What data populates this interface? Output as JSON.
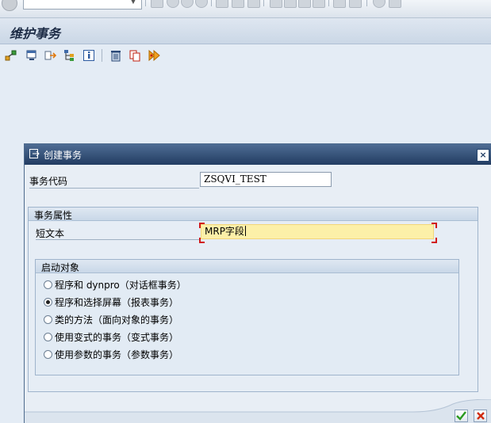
{
  "colors": {
    "title_text": "#1d2c46",
    "dialog_header": "#223c62",
    "active_field": "#fcf0a8",
    "required_marker": "#d11a1a",
    "confirm": "#2a9a1e",
    "cancel": "#d02a10"
  },
  "systembar": {
    "command_field_value": "",
    "icons": [
      "ok-icon",
      "command-dropdown-icon",
      "back-icon",
      "exit-icon",
      "cancel-icon",
      "print-icon",
      "find-icon",
      "find-next-icon",
      "first-page-icon",
      "previous-page-icon",
      "next-page-icon",
      "last-page-icon",
      "new-session-icon",
      "shortcut-icon",
      "help-icon",
      "layout-icon"
    ]
  },
  "header": {
    "title": "维护事务"
  },
  "toolbar": {
    "icons": [
      "other-object-icon",
      "display-change-icon",
      "where-used-icon",
      "hierarchy-icon",
      "info-icon",
      "delete-icon",
      "copy-icon",
      "test-icon"
    ]
  },
  "dialog": {
    "title": "创建事务",
    "close_label": "×",
    "tcode_label": "事务代码",
    "tcode_value": "ZSQVI_TEST",
    "attributes": {
      "title": "事务属性",
      "short_text_label": "短文本",
      "short_text_value": "MRP字段"
    },
    "start_object": {
      "title": "启动对象",
      "options": [
        {
          "label": "程序和 dynpro（对话框事务）",
          "selected": false
        },
        {
          "label": "程序和选择屏幕（报表事务）",
          "selected": true
        },
        {
          "label": "类的方法（面向对象的事务）",
          "selected": false
        },
        {
          "label": "使用变式的事务（变式事务）",
          "selected": false
        },
        {
          "label": "使用参数的事务（参数事务）",
          "selected": false
        }
      ]
    },
    "buttons": [
      "confirm-icon",
      "cancel-icon"
    ]
  }
}
